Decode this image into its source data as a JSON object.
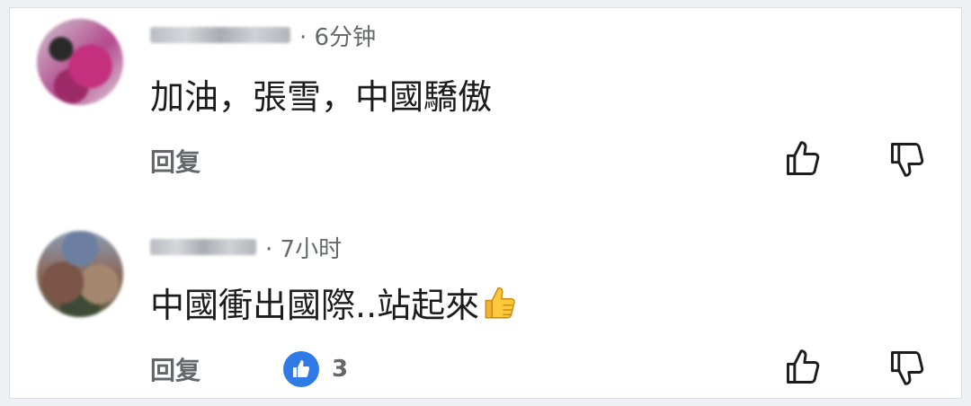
{
  "comments": [
    {
      "time": "· 6分钟",
      "text": "加油，張雪，中國驕傲",
      "reply_label": "回复",
      "upvote_icon": "thumbs-up-outline-icon",
      "downvote_icon": "thumbs-down-outline-icon"
    },
    {
      "time": "· 7小时",
      "text": "中國衝出國際..站起來",
      "emoji": "thumbs-up-emoji",
      "reply_label": "回复",
      "like_count": "3",
      "like_badge_color": "#2f7ae5",
      "upvote_icon": "thumbs-up-outline-icon",
      "downvote_icon": "thumbs-down-outline-icon"
    }
  ]
}
